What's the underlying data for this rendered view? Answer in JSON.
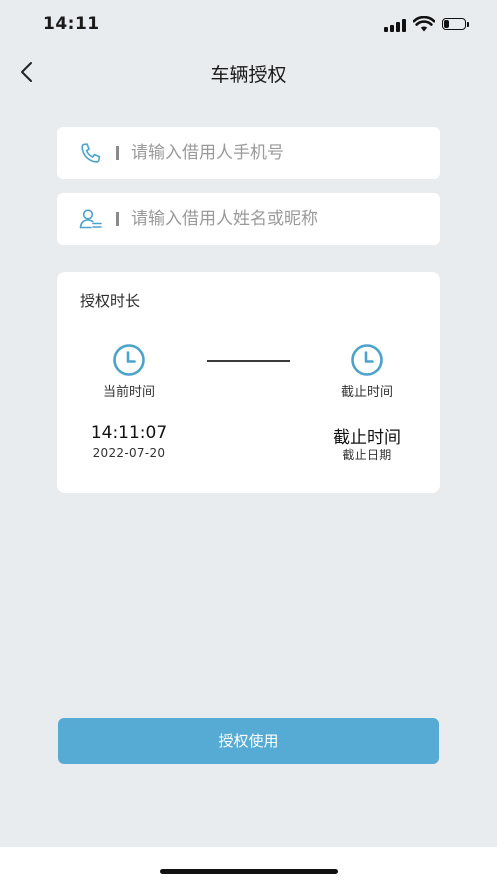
{
  "status_bar": {
    "time": "14:11",
    "battery_level": 0.25
  },
  "header": {
    "title": "车辆授权",
    "back_icon": "chevron-left-icon"
  },
  "form": {
    "phone": {
      "icon": "phone-icon",
      "placeholder": "请输入借用人手机号",
      "value": ""
    },
    "name": {
      "icon": "user-list-icon",
      "placeholder": "请输入借用人姓名或昵称",
      "value": ""
    }
  },
  "auth_duration": {
    "title": "授权时长",
    "start": {
      "icon": "clock-icon",
      "label": "当前时间",
      "time": "14:11:07",
      "date": "2022-07-20"
    },
    "end": {
      "icon": "clock-icon",
      "label": "截止时间",
      "time": "截止时间",
      "date": "截止日期"
    }
  },
  "actions": {
    "submit_label": "授权使用"
  },
  "colors": {
    "background": "#E9ECEF",
    "accent": "#55ABD3",
    "icon": "#4BA3CC"
  }
}
